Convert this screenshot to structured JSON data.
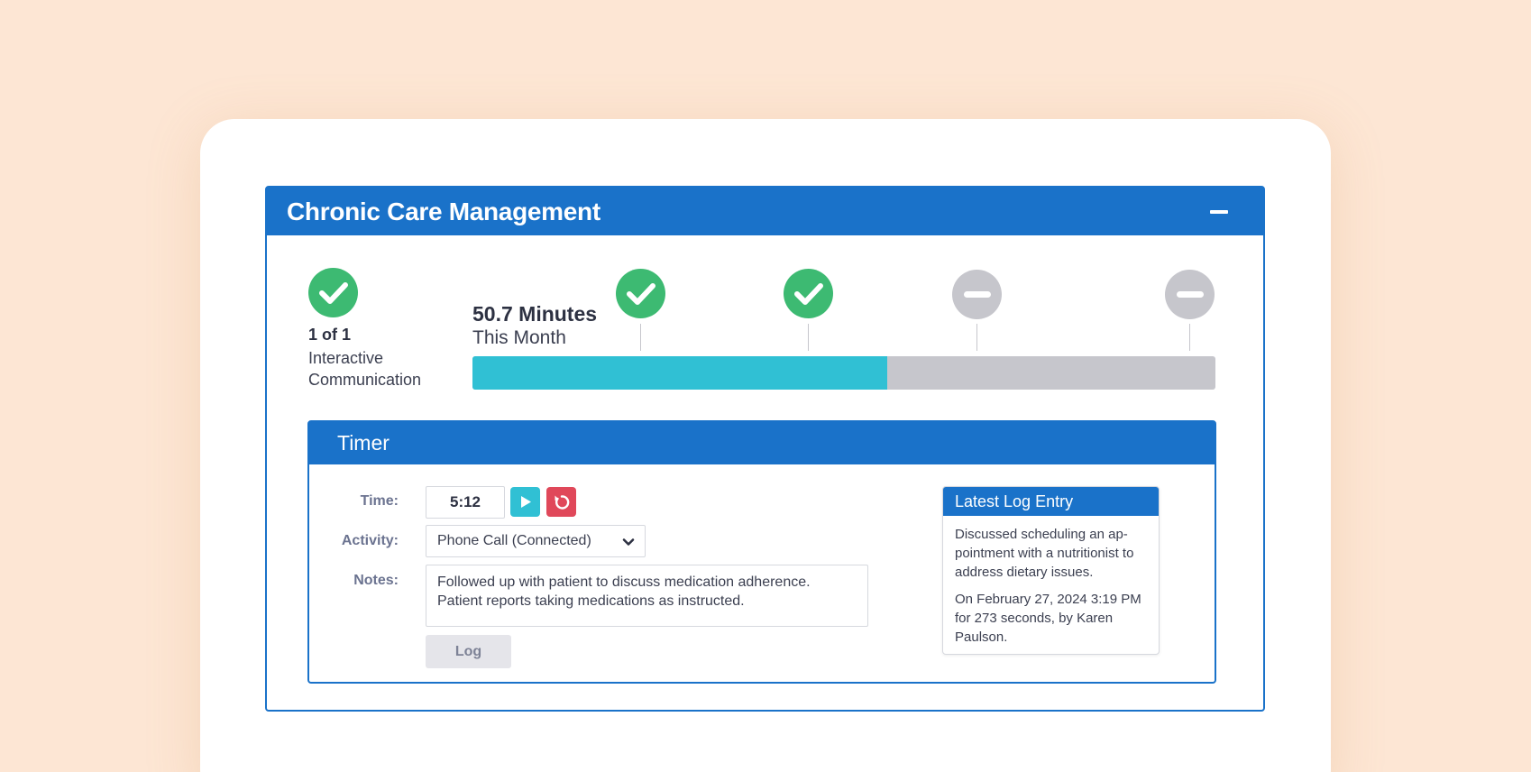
{
  "panel": {
    "title": "Chronic Care Management"
  },
  "progress": {
    "interactive_count": "1 of 1",
    "interactive_label": "Interactive Communication",
    "minutes_value": "50.7 Minutes",
    "minutes_label": "This Month",
    "fill_fraction": 0.558,
    "milestones": [
      "done",
      "done",
      "pending",
      "pending"
    ]
  },
  "timer": {
    "title": "Timer",
    "time_label": "Time:",
    "time_value": "5:12",
    "activity_label": "Activity:",
    "activity_selected": "Phone Call (Connected)",
    "notes_label": "Notes:",
    "notes_value": "Followed up with patient to discuss medication adherence. Patient reports taking medications as instructed.",
    "log_button": "Log"
  },
  "log_entry": {
    "title": "Latest Log Entry",
    "summary": "Discussed scheduling an ap-pointment with a nutritionist to address dietary issues.",
    "meta": "On February 27, 2024 3:19 PM for 273 seconds, by Karen Paulson."
  },
  "colors": {
    "primary": "#1a72c9",
    "success": "#3dba72",
    "pending": "#c6c6cc",
    "progress": "#30c0d4",
    "danger": "#e0485a",
    "background": "#fde6d4"
  }
}
